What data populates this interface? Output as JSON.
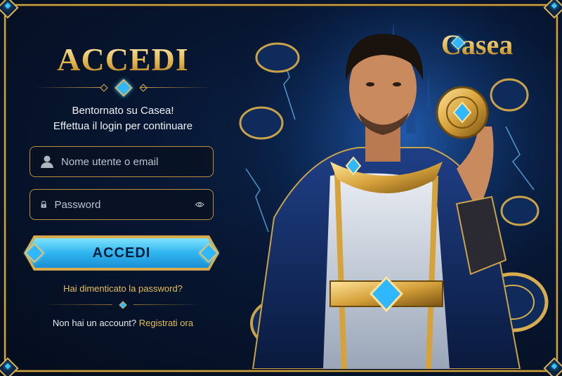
{
  "login": {
    "title": "ACCEDI",
    "welcome_line1": "Bentornato su Casea!",
    "welcome_line2": "Effettua il login per continuare",
    "username_placeholder": "Nome utente o email",
    "password_placeholder": "Password",
    "submit_label": "ACCEDI",
    "forgot_password": "Hai dimenticato la password?",
    "no_account_text": "Non hai un account?",
    "register_link": "Registrati ora"
  },
  "brand": {
    "logo_text": "Casea"
  },
  "icons": {
    "username": "user-icon",
    "password": "lock-icon",
    "show_password": "eye-icon"
  },
  "colors": {
    "gold": "#d6ac4f",
    "button_blue": "#2fb5ef",
    "background": "#071632",
    "link": "#e7bf5a"
  }
}
